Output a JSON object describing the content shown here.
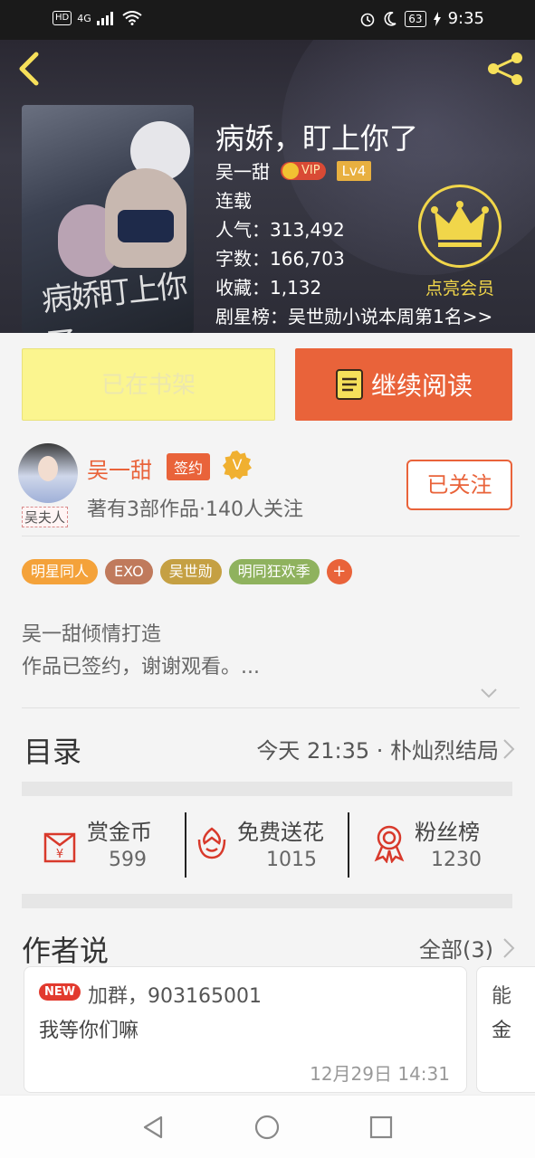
{
  "status_bar": {
    "left_badge": "HD",
    "network": "4G",
    "battery": "63",
    "time": "9:35"
  },
  "book": {
    "title": "病娇，盯上你了",
    "author": "吴一甜",
    "vip_label": "VIP",
    "level": "Lv4",
    "status": "连载",
    "popularity_label": "人气：",
    "popularity": "313,492",
    "words_label": "字数：",
    "words": "166,703",
    "favorites_label": "收藏：",
    "favorites": "1,132",
    "ranking_label": "剧星榜：",
    "ranking": "吴世勋小说本周第1名>>",
    "cover_art_text": "病娇盯上你了"
  },
  "vip_member": {
    "label": "点亮会员"
  },
  "actions": {
    "shelf_label": "已在书架",
    "read_label": "继续阅读"
  },
  "author_info": {
    "name": "吴一甜",
    "sign_badge": "签约",
    "v_badge": "V",
    "avatar_tag": "吴夫人",
    "stats": "著有3部作品·140人关注",
    "follow_label": "已关注"
  },
  "tags": [
    {
      "label": "明星同人",
      "color": "#f4a23a"
    },
    {
      "label": "EXO",
      "color": "#c07a5c"
    },
    {
      "label": "吴世勋",
      "color": "#c5a043"
    },
    {
      "label": "明同狂欢季",
      "color": "#8fb25e"
    },
    {
      "label": "+",
      "color": "#e9633a"
    }
  ],
  "description": {
    "line1": "吴一甜倾情打造",
    "line2": "作品已签约，谢谢观看。..."
  },
  "catalog": {
    "title": "目录",
    "latest": "今天 21:35 · 朴灿烈结局"
  },
  "stats": [
    {
      "label": "赏金币",
      "value": "599",
      "icon": "red-envelope-icon"
    },
    {
      "label": "免费送花",
      "value": "1015",
      "icon": "flower-icon"
    },
    {
      "label": "粉丝榜",
      "value": "1230",
      "icon": "medal-icon"
    }
  ],
  "author_says": {
    "title": "作者说",
    "all_label": "全部(3)",
    "cards": [
      {
        "badge": "NEW",
        "line1": "加群，903165001",
        "line2": "我等你们嘛",
        "time": "12月29日  14:31"
      },
      {
        "line1": "能",
        "line2": "金"
      }
    ]
  },
  "colors": {
    "accent": "#e9633a",
    "shelf_bg": "#fbf58f",
    "vip_gold": "#f1d64a"
  }
}
